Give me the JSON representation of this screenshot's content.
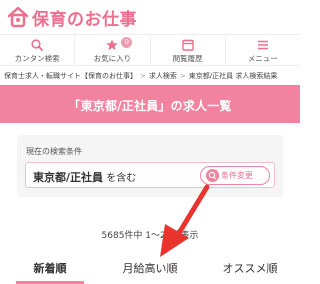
{
  "header": {
    "logo_text": "保育のお仕事",
    "brand_color": "#ec6f8d"
  },
  "nav": {
    "items": [
      {
        "label": "カンタン検索",
        "icon": "search-icon"
      },
      {
        "label": "お気に入り",
        "icon": "star-icon",
        "badge": "0"
      },
      {
        "label": "閲覧履歴",
        "icon": "calendar-icon"
      },
      {
        "label": "メニュー",
        "icon": "menu-icon"
      }
    ]
  },
  "breadcrumb": {
    "items": [
      "保育士求人・転職サイト【保育のお仕事】",
      "求人検索",
      "東京都/正社員 求人検索結果"
    ],
    "separator": ">"
  },
  "page_title": "「東京都/正社員」の求人一覧",
  "search_condition": {
    "label": "現在の検索条件",
    "value_bold": "東京都/正社員",
    "value_suffix": "を含む",
    "change_button": "条件変更"
  },
  "result_count": "5685件中 1〜20件表示",
  "sort_tabs": [
    {
      "label": "新着順",
      "active": true
    },
    {
      "label": "月給高い順",
      "active": false
    },
    {
      "label": "オススメ順",
      "active": false
    }
  ],
  "colors": {
    "accent": "#f283a0",
    "arrow": "#e8342c"
  }
}
